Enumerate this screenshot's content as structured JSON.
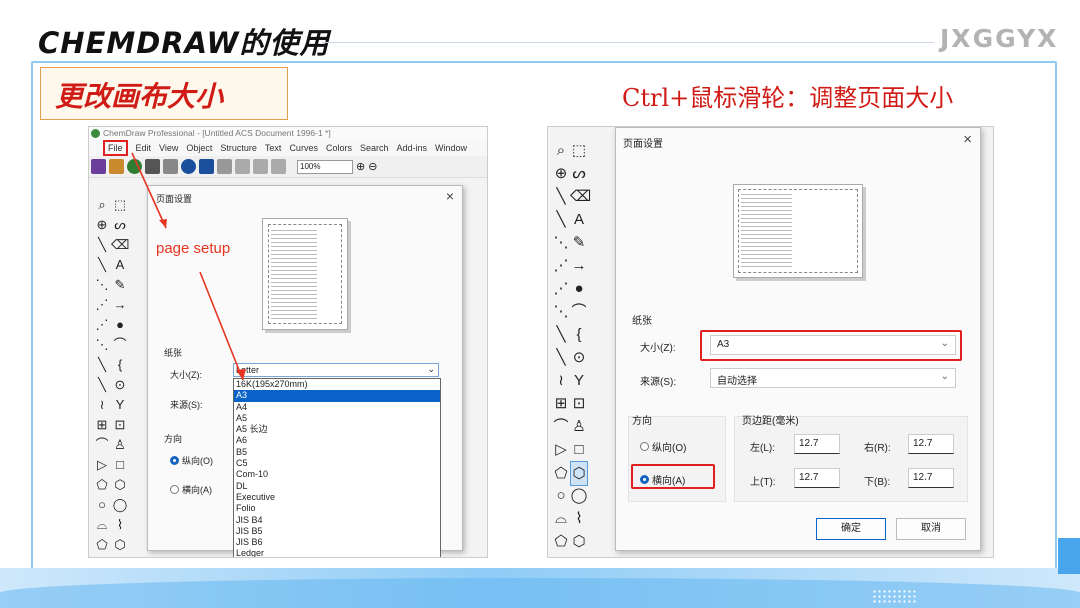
{
  "slide": {
    "title": "CHEMDRAW的使用",
    "brand": "JXGGYX",
    "callout": "更改画布大小",
    "hint": "Ctrl+鼠标滑轮：调整页面大小"
  },
  "left": {
    "app_title": "ChemDraw Professional - [Untitled ACS Document 1996-1 *]",
    "menu": [
      "File",
      "Edit",
      "View",
      "Object",
      "Structure",
      "Text",
      "Curves",
      "Colors",
      "Search",
      "Add-ins",
      "Window"
    ],
    "zoom": "100%",
    "dialog_title": "页面设置",
    "annotation": "page setup",
    "paper_group": "纸张",
    "size_label": "大小(Z):",
    "size_value": "Letter",
    "source_label": "来源(S):",
    "orientation_group": "方向",
    "portrait": "纵向(O)",
    "landscape": "横向(A)",
    "size_options": [
      "16K(195x270mm)",
      "A3",
      "A4",
      "A5",
      "A5 长边",
      "A6",
      "B5",
      "C5",
      "Com-10",
      "DL",
      "Executive",
      "Folio",
      "JIS B4",
      "JIS B5",
      "JIS B6",
      "Ledger"
    ],
    "selected_option": "A3"
  },
  "right": {
    "dialog_title": "页面设置",
    "paper_group": "纸张",
    "size_label": "大小(Z):",
    "size_value": "A3",
    "source_label": "来源(S):",
    "source_value": "自动选择",
    "orientation_group": "方向",
    "portrait": "纵向(O)",
    "landscape": "横向(A)",
    "margins_group": "页边距(毫米)",
    "left_label": "左(L):",
    "left_value": "12.7",
    "right_label": "右(R):",
    "right_value": "12.7",
    "top_label": "上(T):",
    "top_value": "12.7",
    "bottom_label": "下(B):",
    "bottom_value": "12.7",
    "ok": "确定",
    "cancel": "取消"
  },
  "palette_icons": [
    "lasso-icon",
    "marquee-icon",
    "chain-icon",
    "ring-tool-icon",
    "bond-icon",
    "eraser-icon",
    "bold-bond-icon",
    "text-icon",
    "hash-bond-icon",
    "pen-icon",
    "dash-bond-icon",
    "arrow-icon",
    "wedge-hash-icon",
    "orbital-icon",
    "wavy-bond-icon",
    "angle-icon",
    "wedge-bond-icon",
    "bracket-icon",
    "dashed-wedge-icon",
    "charge-icon",
    "zigzag-icon",
    "query-icon",
    "table-icon",
    "template-icon",
    "curve-icon",
    "stamp-icon",
    "triangle-icon",
    "square-icon",
    "pentagon-icon",
    "hexagon-icon",
    "circle-icon",
    "circle2-icon",
    "boat-icon",
    "chair-icon",
    "cyclopentane-icon",
    "cyclohexane-icon"
  ]
}
